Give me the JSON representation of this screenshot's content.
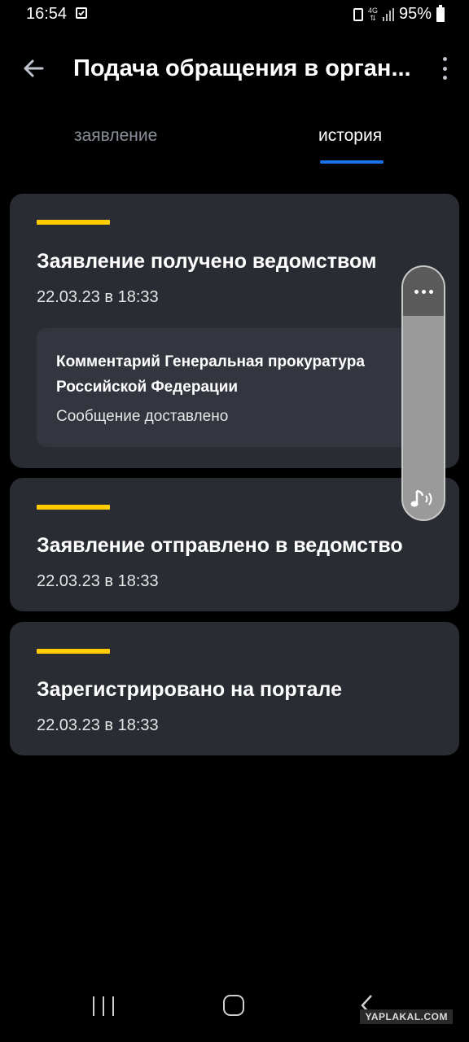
{
  "status_bar": {
    "time": "16:54",
    "network": "4G",
    "battery_percent": "95%"
  },
  "app_bar": {
    "title": "Подача обращения в орган..."
  },
  "tabs": [
    {
      "label": "заявление",
      "active": false
    },
    {
      "label": "история",
      "active": true
    }
  ],
  "history": [
    {
      "title": "Заявление получено ведомством",
      "date": "22.03.23 в 18:33",
      "comment": {
        "title": "Комментарий Генеральная прокуратура Российской Федерации",
        "status": "Сообщение доставлено"
      }
    },
    {
      "title": "Заявление отправлено в ведомство",
      "date": "22.03.23 в 18:33"
    },
    {
      "title": "Зарегистрировано на портале",
      "date": "22.03.23 в 18:33"
    }
  ],
  "watermark": "YAPLAKAL.COM",
  "colors": {
    "accent_yellow": "#ffcc00",
    "tab_indicator": "#1a73e8",
    "card_bg": "#2a2c33",
    "comment_bg": "#33363e"
  }
}
